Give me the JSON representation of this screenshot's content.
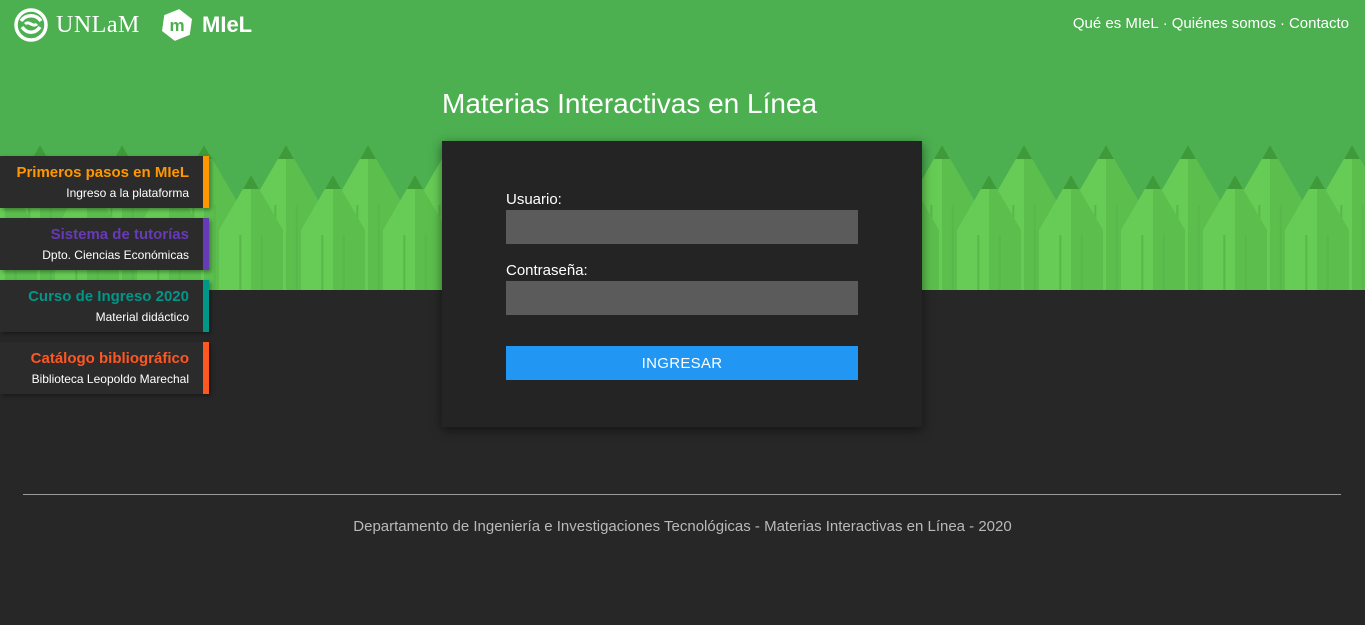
{
  "header": {
    "unlam_logo_text": "UNLaM",
    "miel_logo_text": "MIeL",
    "miel_icon_letter": "m",
    "nav": [
      {
        "label": "Qué es MIeL"
      },
      {
        "label": "Quiénes somos"
      },
      {
        "label": "Contacto"
      }
    ],
    "nav_separator": "·"
  },
  "hero": {
    "title": "Materias Interactivas en Línea",
    "background_color": "#4caf50"
  },
  "sidebar": {
    "cards": [
      {
        "title": "Primeros pasos en MIeL",
        "subtitle": "Ingreso a la plataforma",
        "color": "#ff9800"
      },
      {
        "title": "Sistema de tutorías",
        "subtitle": "Dpto. Ciencias Económicas",
        "color": "#673ab7"
      },
      {
        "title": "Curso de Ingreso 2020",
        "subtitle": "Material didáctico",
        "color": "#009688"
      },
      {
        "title": "Catálogo bibliográfico",
        "subtitle": "Biblioteca Leopoldo Marechal",
        "color": "#ff5722"
      }
    ]
  },
  "login": {
    "user_label": "Usuario:",
    "user_value": "",
    "password_label": "Contraseña:",
    "password_value": "",
    "submit_label": "INGRESAR",
    "submit_color": "#2196f3"
  },
  "footer": {
    "text": "Departamento de Ingeniería e Investigaciones Tecnológicas - Materias Interactivas en Línea - 2020"
  }
}
